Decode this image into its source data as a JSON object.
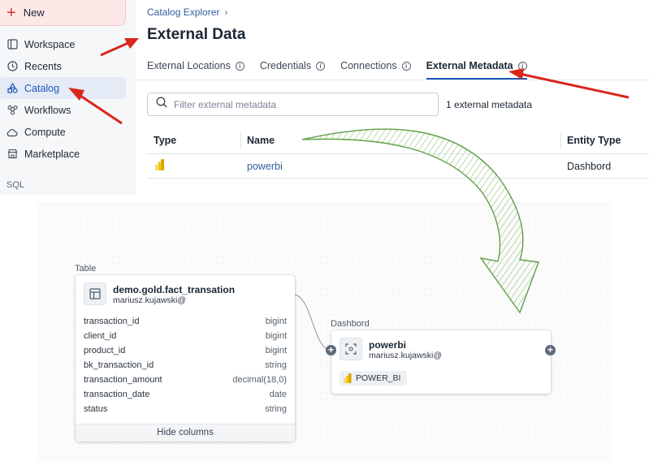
{
  "sidebar": {
    "new_label": "New",
    "items": [
      {
        "label": "Workspace",
        "icon": "workspace-icon"
      },
      {
        "label": "Recents",
        "icon": "clock-icon"
      },
      {
        "label": "Catalog",
        "icon": "catalog-icon",
        "active": true
      },
      {
        "label": "Workflows",
        "icon": "workflows-icon"
      },
      {
        "label": "Compute",
        "icon": "cloud-icon"
      },
      {
        "label": "Marketplace",
        "icon": "store-icon"
      }
    ],
    "section_sql": "SQL"
  },
  "header": {
    "breadcrumb": "Catalog Explorer",
    "title": "External Data"
  },
  "tabs": [
    {
      "label": "External Locations"
    },
    {
      "label": "Credentials"
    },
    {
      "label": "Connections"
    },
    {
      "label": "External Metadata",
      "active": true
    }
  ],
  "search": {
    "placeholder": "Filter external metadata",
    "count_text": "1 external metadata"
  },
  "table": {
    "headers": [
      "Type",
      "Name",
      "Entity Type"
    ],
    "rows": [
      {
        "type_icon": "powerbi-icon",
        "name": "powerbi",
        "entity_type": "Dashbord"
      }
    ]
  },
  "lineage": {
    "table_node": {
      "type_label": "Table",
      "title": "demo.gold.fact_transation",
      "owner": "mariusz.kujawski@",
      "columns": [
        {
          "name": "transaction_id",
          "type": "bigint"
        },
        {
          "name": "client_id",
          "type": "bigint"
        },
        {
          "name": "product_id",
          "type": "bigint"
        },
        {
          "name": "bk_transaction_id",
          "type": "string"
        },
        {
          "name": "transaction_amount",
          "type": "decimal(18,0)"
        },
        {
          "name": "transaction_date",
          "type": "date"
        },
        {
          "name": "status",
          "type": "string"
        }
      ],
      "hide_columns_label": "Hide columns"
    },
    "dashboard_node": {
      "type_label": "Dashbord",
      "title": "powerbi",
      "owner": "mariusz.kujawski@",
      "badge": "POWER_BI"
    }
  },
  "colors": {
    "accent": "#1b58b8",
    "new_red": "#e0312d",
    "annotation_arrow": "#d9261c",
    "sketch_arrow": "#6aa84f"
  }
}
